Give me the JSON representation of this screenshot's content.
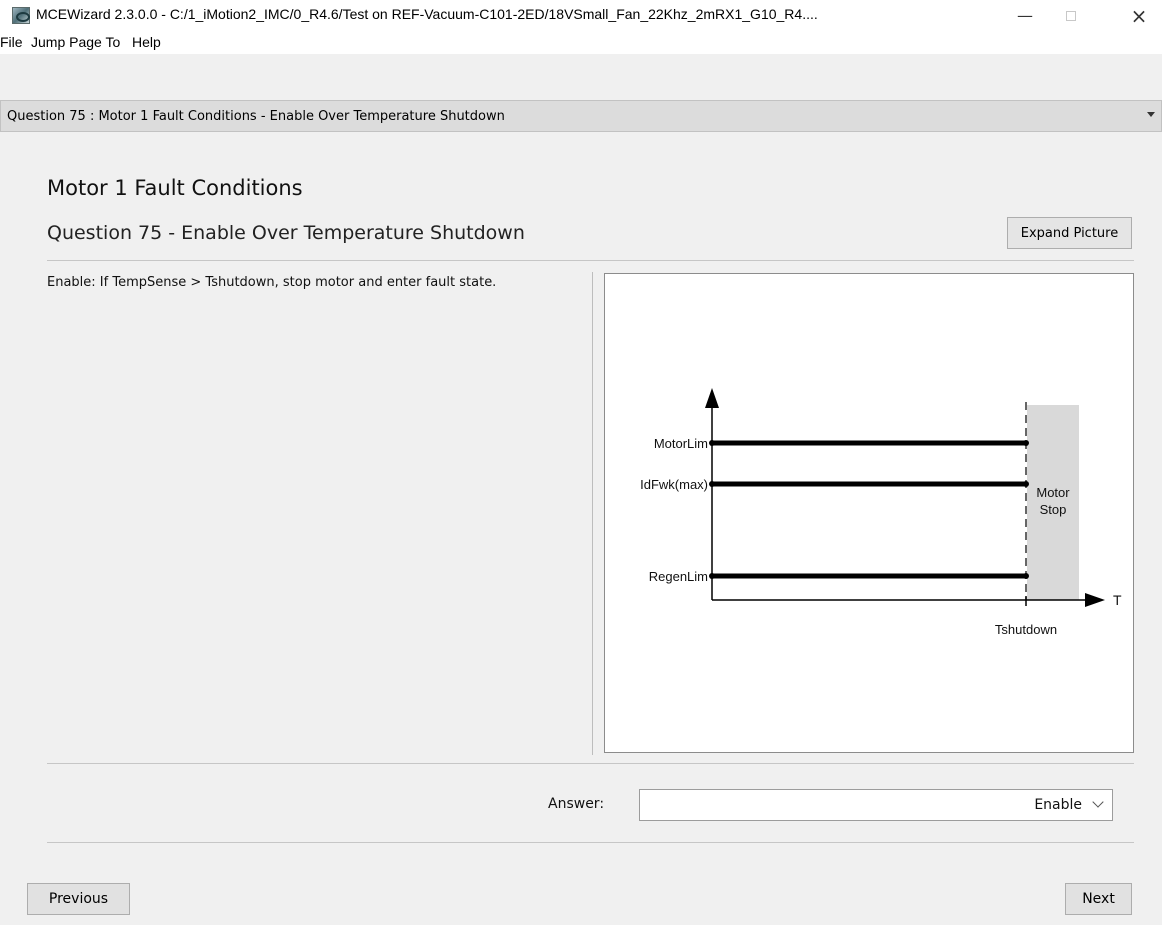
{
  "window": {
    "title": "MCEWizard 2.3.0.0  - C:/1_iMotion2_IMC/0_R4.6/Test on REF-Vacuum-C101-2ED/18VSmall_Fan_22Khz_2mRX1_G10_R4....",
    "icon": "app-icon",
    "minimize_glyph": "—",
    "close_glyph": "×"
  },
  "menubar": {
    "items": [
      "File",
      "Jump Page To",
      "Help"
    ]
  },
  "question_select": {
    "selected": "Question  75 : Motor 1 Fault Conditions - Enable Over Temperature Shutdown"
  },
  "page": {
    "heading": "Motor 1 Fault Conditions",
    "question_title": "Question 75 - Enable Over Temperature Shutdown",
    "expand_button": "Expand Picture",
    "description": "Enable: If TempSense > Tshutdown, stop motor and enter fault state."
  },
  "diagram": {
    "labels": {
      "motor_lim": "MotorLim",
      "idfwk_max": "IdFwk(max)",
      "regen_lim": "RegenLim",
      "motor_stop_1": "Motor",
      "motor_stop_2": "Stop",
      "x_axis": "T",
      "tshutdown": "Tshutdown"
    },
    "colors": {
      "line": "#000000",
      "shade": "#d9d9d9"
    }
  },
  "answer": {
    "label": "Answer:",
    "value": "Enable"
  },
  "nav": {
    "previous": "Previous",
    "next": "Next"
  }
}
